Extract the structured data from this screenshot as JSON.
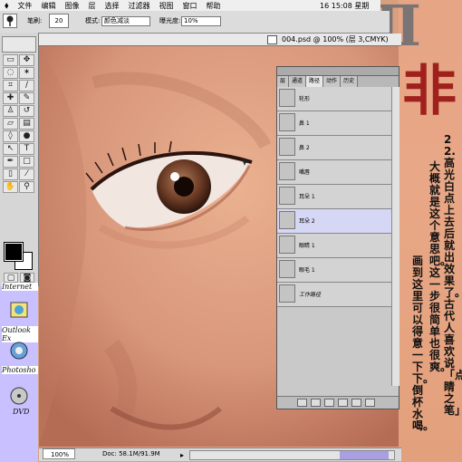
{
  "menubar": {
    "items": [
      "文件",
      "编辑",
      "图像",
      "层",
      "选择",
      "过滤器",
      "视图",
      "窗口",
      "帮助"
    ],
    "clock": "16 15:08 星期"
  },
  "options": {
    "brush_label": "笔刷:",
    "brush_size": "20",
    "mode_label": "模式:",
    "mode_value": "颜色减淡",
    "exposure_label": "曝光度:",
    "exposure_value": "10%"
  },
  "document": {
    "title": "004.psd @ 100% (层 3,CMYK)",
    "zoom": "100%",
    "doc_size": "Doc: 58.1M/91.9M"
  },
  "palette": {
    "tabs": [
      "层",
      "通道",
      "路径",
      "动作",
      "历史"
    ],
    "active_tab_index": 2,
    "rows": [
      "轮形",
      "鼻 1",
      "鼻 2",
      "嘴唇",
      "耳朵 1",
      "耳朵 2",
      "眼睛 1",
      "眼毛 1",
      "工作路径"
    ],
    "selected_row_index": 5
  },
  "desktop": {
    "icons": [
      "Internet",
      "Outlook Ex",
      "Photosho",
      "DVD"
    ]
  },
  "right_page": {
    "glyph_top": "II",
    "glyph_red": "非",
    "col1": "22.高光白点上去后就出效果了。古代人喜欢说「点睛之笔」",
    "col2": "大概就是这个意思吧。这一步很简单也很爽。",
    "col3": "画到这里可以得意一下下。倒杯水喝。"
  },
  "colors": {
    "foreground": "#000000",
    "background": "#ffffff",
    "selected_row": "#d6d6f5",
    "red_glyph": "#a0201e"
  }
}
